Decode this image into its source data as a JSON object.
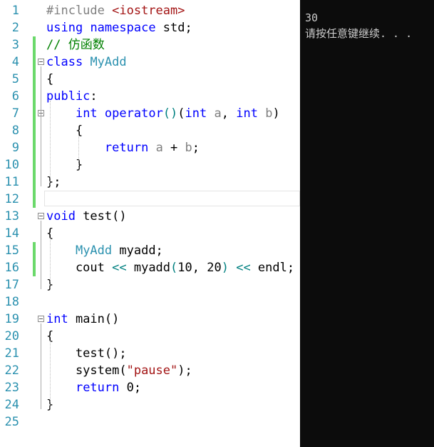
{
  "editor": {
    "lines": [
      {
        "n": "1",
        "tokens": [
          {
            "t": "#include ",
            "c": "pp"
          },
          {
            "t": "<iostream>",
            "c": "st"
          }
        ]
      },
      {
        "n": "2",
        "tokens": [
          {
            "t": "using",
            "c": "kw"
          },
          {
            "t": " ",
            "c": "nm"
          },
          {
            "t": "namespace",
            "c": "kw"
          },
          {
            "t": " std;",
            "c": "nm"
          }
        ]
      },
      {
        "n": "3",
        "tokens": [
          {
            "t": "// 仿函数",
            "c": "cm"
          }
        ]
      },
      {
        "n": "4",
        "tokens": [
          {
            "t": "class",
            "c": "kw"
          },
          {
            "t": " ",
            "c": "nm"
          },
          {
            "t": "MyAdd",
            "c": "ty"
          }
        ]
      },
      {
        "n": "5",
        "tokens": [
          {
            "t": "{",
            "c": "nm"
          }
        ]
      },
      {
        "n": "6",
        "tokens": [
          {
            "t": "public",
            "c": "kw"
          },
          {
            "t": ":",
            "c": "nm"
          }
        ]
      },
      {
        "n": "7",
        "tokens": [
          {
            "t": "    ",
            "c": "nm"
          },
          {
            "t": "int",
            "c": "kw"
          },
          {
            "t": " ",
            "c": "nm"
          },
          {
            "t": "operator",
            "c": "kw"
          },
          {
            "t": "()",
            "c": "op"
          },
          {
            "t": "(",
            "c": "nm"
          },
          {
            "t": "int",
            "c": "kw"
          },
          {
            "t": " ",
            "c": "nm"
          },
          {
            "t": "a",
            "c": "pm"
          },
          {
            "t": ", ",
            "c": "nm"
          },
          {
            "t": "int",
            "c": "kw"
          },
          {
            "t": " ",
            "c": "nm"
          },
          {
            "t": "b",
            "c": "pm"
          },
          {
            "t": ")",
            "c": "nm"
          }
        ]
      },
      {
        "n": "8",
        "tokens": [
          {
            "t": "    {",
            "c": "nm"
          }
        ]
      },
      {
        "n": "9",
        "tokens": [
          {
            "t": "        ",
            "c": "nm"
          },
          {
            "t": "return",
            "c": "kw"
          },
          {
            "t": " ",
            "c": "nm"
          },
          {
            "t": "a",
            "c": "pm"
          },
          {
            "t": " + ",
            "c": "nm"
          },
          {
            "t": "b",
            "c": "pm"
          },
          {
            "t": ";",
            "c": "nm"
          }
        ]
      },
      {
        "n": "10",
        "tokens": [
          {
            "t": "    }",
            "c": "nm"
          }
        ]
      },
      {
        "n": "11",
        "tokens": [
          {
            "t": "};",
            "c": "nm"
          }
        ]
      },
      {
        "n": "12",
        "tokens": []
      },
      {
        "n": "13",
        "tokens": [
          {
            "t": "void",
            "c": "kw"
          },
          {
            "t": " test()",
            "c": "nm"
          }
        ]
      },
      {
        "n": "14",
        "tokens": [
          {
            "t": "{",
            "c": "nm"
          }
        ]
      },
      {
        "n": "15",
        "tokens": [
          {
            "t": "    ",
            "c": "nm"
          },
          {
            "t": "MyAdd",
            "c": "ty"
          },
          {
            "t": " myadd;",
            "c": "nm"
          }
        ]
      },
      {
        "n": "16",
        "tokens": [
          {
            "t": "    cout ",
            "c": "nm"
          },
          {
            "t": "<<",
            "c": "op"
          },
          {
            "t": " myadd",
            "c": "nm"
          },
          {
            "t": "(",
            "c": "op"
          },
          {
            "t": "10, 20",
            "c": "nm"
          },
          {
            "t": ")",
            "c": "op"
          },
          {
            "t": " ",
            "c": "nm"
          },
          {
            "t": "<<",
            "c": "op"
          },
          {
            "t": " endl;",
            "c": "nm"
          }
        ]
      },
      {
        "n": "17",
        "tokens": [
          {
            "t": "}",
            "c": "nm"
          }
        ]
      },
      {
        "n": "18",
        "tokens": []
      },
      {
        "n": "19",
        "tokens": [
          {
            "t": "int",
            "c": "kw"
          },
          {
            "t": " main()",
            "c": "nm"
          }
        ]
      },
      {
        "n": "20",
        "tokens": [
          {
            "t": "{",
            "c": "nm"
          }
        ]
      },
      {
        "n": "21",
        "tokens": [
          {
            "t": "    test();",
            "c": "nm"
          }
        ]
      },
      {
        "n": "22",
        "tokens": [
          {
            "t": "    system(",
            "c": "nm"
          },
          {
            "t": "\"pause\"",
            "c": "st"
          },
          {
            "t": ");",
            "c": "nm"
          }
        ]
      },
      {
        "n": "23",
        "tokens": [
          {
            "t": "    ",
            "c": "nm"
          },
          {
            "t": "return",
            "c": "kw"
          },
          {
            "t": " 0;",
            "c": "nm"
          }
        ]
      },
      {
        "n": "24",
        "tokens": [
          {
            "t": "}",
            "c": "nm"
          }
        ]
      },
      {
        "n": "25",
        "tokens": []
      }
    ],
    "changed_lines": [
      "3",
      "4",
      "5",
      "6",
      "7",
      "8",
      "9",
      "10",
      "11",
      "12",
      "15",
      "16"
    ],
    "fold_lines": [
      "4",
      "7",
      "13",
      "19"
    ],
    "current_line": "12",
    "colors": {
      "keyword": "#0000ff",
      "type": "#2b91af",
      "comment": "#008000",
      "string": "#a31515",
      "preproc": "#808080",
      "change_bar": "#6bd96b"
    }
  },
  "console": {
    "output": "30",
    "prompt": "请按任意键继续. . ."
  }
}
